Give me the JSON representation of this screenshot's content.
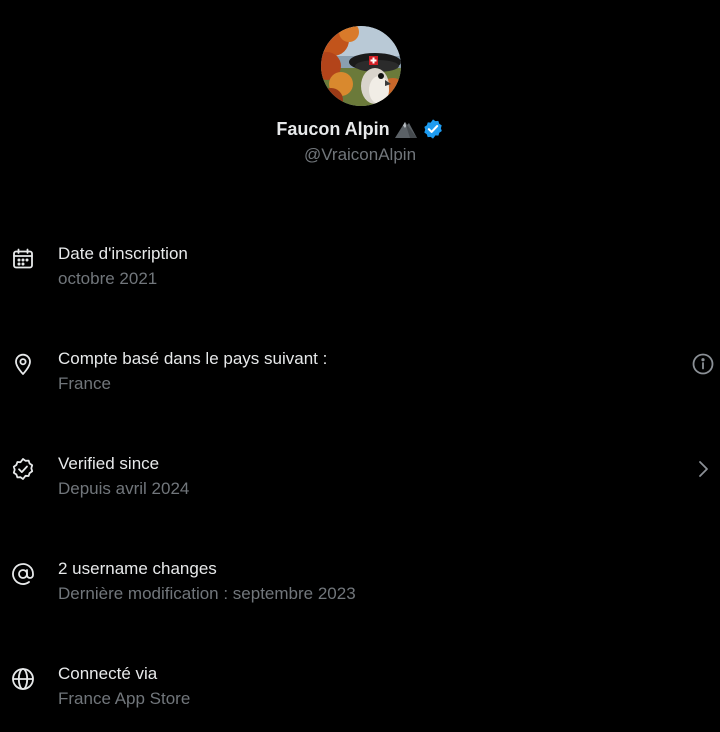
{
  "profile": {
    "display_name": "Faucon Alpin",
    "handle": "@VraiconAlpin",
    "name_emoji": "mountain-icon",
    "verified_badge": "verified-badge-icon",
    "verified_color": "#1d9bf0"
  },
  "about": [
    {
      "icon": "calendar-icon",
      "title": "Date d'inscription",
      "subtitle": "octobre 2021"
    },
    {
      "icon": "location-pin-icon",
      "title": "Compte basé dans le pays suivant :",
      "subtitle": "France",
      "trailing_icon": "info-icon"
    },
    {
      "icon": "verified-outline-icon",
      "title": "Verified since",
      "subtitle": "Depuis avril 2024",
      "trailing_icon": "chevron-right-icon"
    },
    {
      "icon": "at-sign-icon",
      "title": "2 username changes",
      "subtitle": "Dernière modification : septembre 2023"
    },
    {
      "icon": "globe-icon",
      "title": "Connecté via",
      "subtitle": "France App Store"
    }
  ],
  "colors": {
    "background": "#000000",
    "primary_text": "#e7e9ea",
    "secondary_text": "#71767b"
  }
}
